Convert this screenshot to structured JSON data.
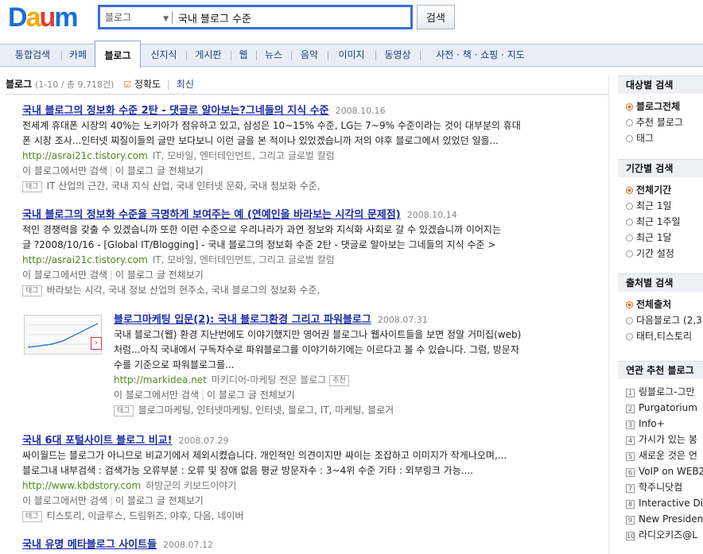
{
  "search": {
    "select_value": "블로그",
    "query": "국내 블로그 수준",
    "button": "검색"
  },
  "tabs": [
    "통합검색",
    "카페",
    "블로그",
    "신지식",
    "게시판",
    "웹",
    "뉴스",
    "음악",
    "이미지",
    "동영상",
    "사전 · 책 · 쇼핑 · 지도"
  ],
  "header": {
    "title": "블로그",
    "count": "(1-10 / 총 9,718건)",
    "sort_accuracy": "정확도",
    "sort_latest": "최신"
  },
  "common": {
    "in_blog": "이 블로그에서만 검색",
    "view_all": "이 블로그 글 전체보기",
    "tag": "태그",
    "recommend": "추천"
  },
  "results": [
    {
      "title": "국내 블로그의 정보화 수준 2탄 - 댓글로 알아보는?그네들의 지식 수준",
      "date": "2008.10.16",
      "snippet1": "전세계 휴대폰 시장의 40%는 노키아가 점유하고 있고, 삼성은 10~15% 수준, LG는 7~9% 수준이라는 것이 대부분의 휴대",
      "snippet2": "폰 시장 조사...인터넷 찌질이들의 글만 보다보니 이런 글을 본 적이나 있었겠습니까 저의 야후 블로그에서 있었던 일을...",
      "url": "http://asrai21c.tistory.com",
      "category": "IT, 모바일, 엔터테인먼트, 그리고 글로벌 칼럼",
      "tags": "IT 산업의 근간, 국내 지식 산업, 국내 인터넷 문화, 국내 정보화 수준,"
    },
    {
      "title": "국내 블로그의 정보화 수준을 극명하게 보여주는 예 (연예인을 바라보는 시각의 문제점)",
      "date": "2008.10.14",
      "snippet1": "적인 경쟁력을 갖출 수 있겠습니까 또한 이런 수준으로 우리나라가 과연 정보와 지식화 사회로 갈 수 있겠습니까 이어지는",
      "snippet2": "글 ?2008/10/16 - [Global IT/Blogging] - 국내 블로그의 정보화 수준 2탄 - 댓글로 알아보는 그네들의 지식 수준 >",
      "url": "http://asrai21c.tistory.com",
      "category": "IT, 모바일, 엔터테인먼트, 그리고 글로벌 칼럼",
      "tags": "바라보는 시각, 국내 정보 산업의 현주소, 국내 블로그의 정보화 수준,"
    },
    {
      "title": "블로그마케팅 입문(2): 국내 블로그환경 그리고 파워블로그",
      "date": "2008.07.31",
      "snippet1": "국내 블로그(웹) 환경 지난번에도 이야기했지만 영어권 블로그나 웹사이트들을 보면 정말 거미집(web)",
      "snippet2": "처럼...아직 국내에서 구독자수로 파워블로그를 이야기하기에는 이르다고 볼 수 있습니다. 그럼, 방문자",
      "snippet3": "수를 기준으로 파워블로그를...",
      "url": "http://markidea.net",
      "category": "마키디어-마케팅 전문 블로그",
      "tags": "블로그마케팅, 인터넷마케팅, 인터넷, 블로그, IT, 마케팅, 블로거"
    },
    {
      "title": "국내 6대 포털사이트 블로그 비교!",
      "date": "2008.07.29",
      "snippet1": "싸이월드는 블로그가 아니므로 비교기에서 제외시켰습니다. 개인적인 의견이지만 싸이는 조잡하고 이미지가 작게나오며,...",
      "snippet2": "블로그내 내부검색 : 검색가능 오류부분 : 오류 및 장애 없음 평균 방문자수 : 3~4위 수준 기타 : 외부링크 가능....",
      "url": "http://www.kbdstory.com",
      "category": "하방군의 키보드이야기",
      "tags": "티스토리, 이글루스, 드림위즈, 야후, 다음, 네이버"
    },
    {
      "title": "국내 유명 메타블로그 사이트들",
      "date": "2008.07.12"
    }
  ],
  "sidebar": {
    "target": {
      "title": "대상별 검색",
      "options": [
        "블로그전체",
        "추천 블로그",
        "태그"
      ]
    },
    "period": {
      "title": "기간별 검색",
      "options": [
        "전체기간",
        "최근 1일",
        "최근 1주일",
        "최근 1달",
        "기간 설정"
      ]
    },
    "source": {
      "title": "출처별 검색",
      "options": [
        "전체출처",
        "다음블로그 (2,3",
        "태터,티스토리"
      ]
    },
    "related": {
      "title": "연관 추천 블로그",
      "items": [
        "링블로그-그만",
        "Purgatorium",
        "Info+",
        "가시가 있는 봉",
        "새로운 것은 언",
        "VoIP on WEB2",
        "학주니닷컴",
        "Interactive Dia",
        "New Presiden",
        "라디오키즈@L"
      ]
    }
  }
}
